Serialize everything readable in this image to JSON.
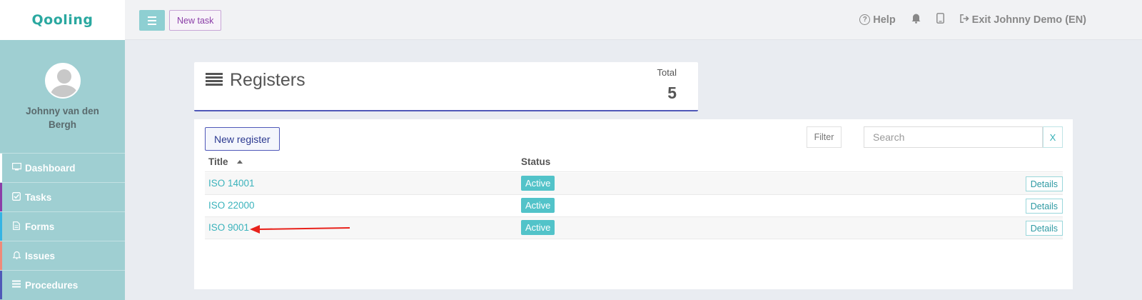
{
  "logo": {
    "text": "Qooling"
  },
  "sidebar": {
    "user_name": "Johnny van den Bergh",
    "items": [
      {
        "label": "Dashboard",
        "icon": "monitor-icon",
        "accent": "#ffffff"
      },
      {
        "label": "Tasks",
        "icon": "check-square-icon",
        "accent": "#8b3ea8"
      },
      {
        "label": "Forms",
        "icon": "document-icon",
        "accent": "#35b4e4"
      },
      {
        "label": "Issues",
        "icon": "bell-icon",
        "accent": "#ef8a7a"
      },
      {
        "label": "Procedures",
        "icon": "list-icon",
        "accent": "#4f58b8"
      }
    ]
  },
  "topbar": {
    "new_task_label": "New task",
    "help_label": "Help",
    "exit_label": "Exit Johnny Demo (EN)"
  },
  "header": {
    "title": "Registers",
    "total_label": "Total",
    "total_value": "5"
  },
  "toolbar": {
    "new_register_label": "New register",
    "filter_label": "Filter",
    "search_placeholder": "Search",
    "clear_label": "X"
  },
  "table": {
    "columns": [
      "Title",
      "Status"
    ],
    "rows": [
      {
        "title": "ISO 14001",
        "status": "Active",
        "action": "Details"
      },
      {
        "title": "ISO 22000",
        "status": "Active",
        "action": "Details"
      },
      {
        "title": "ISO 9001",
        "status": "Active",
        "action": "Details"
      }
    ]
  },
  "colors": {
    "brand": "#2aa8a0",
    "sidebar": "#9fcfd2",
    "accent_blue": "#4f58b8",
    "status_active": "#52c3c9",
    "annotation_arrow": "#e8221b"
  }
}
